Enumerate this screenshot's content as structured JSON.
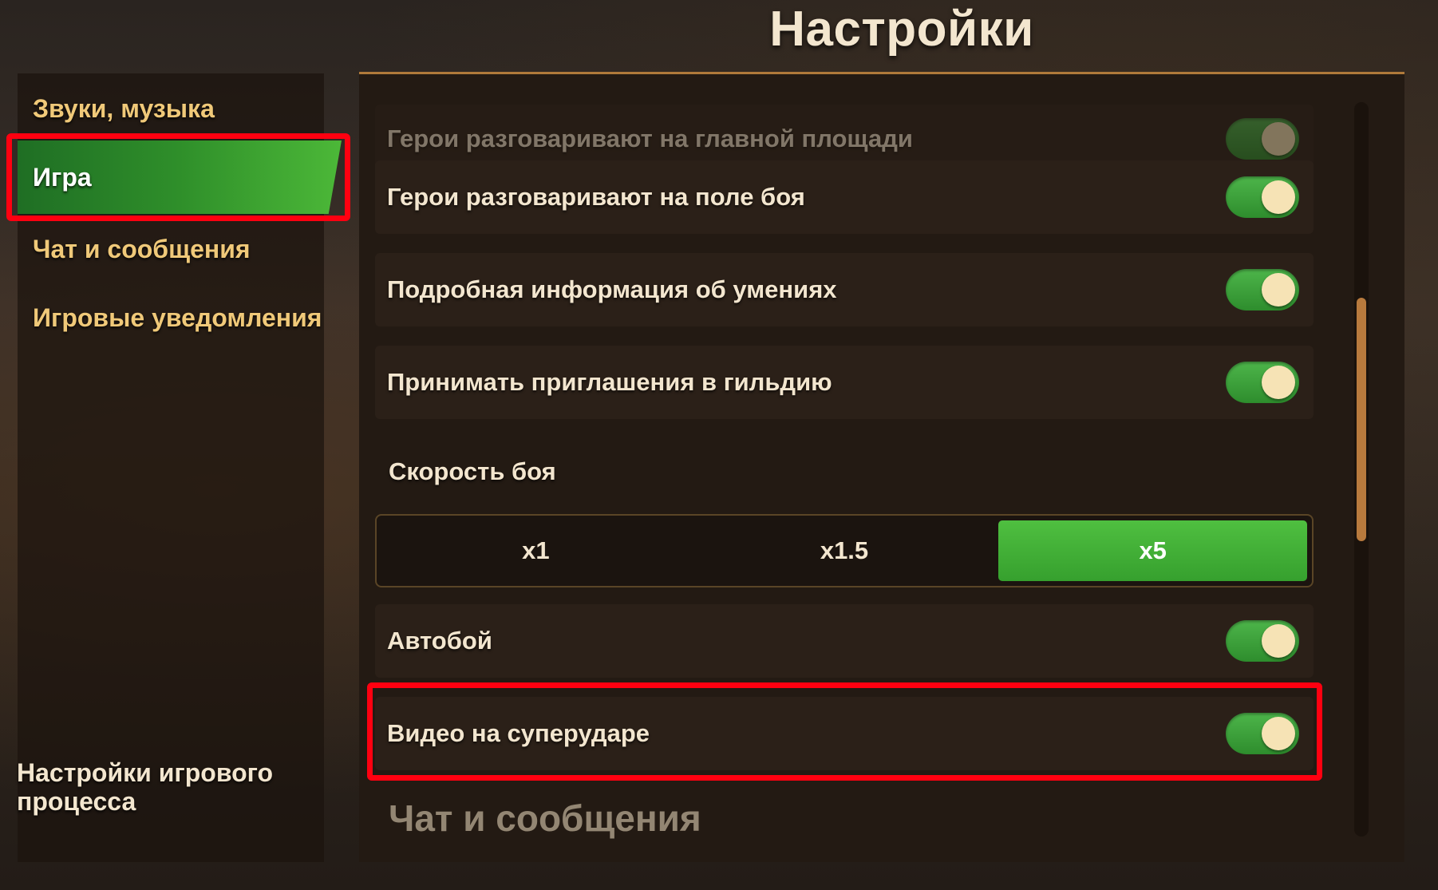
{
  "title": "Настройки",
  "sidebar": {
    "items": [
      {
        "label": "Звуки, музыка"
      },
      {
        "label": "Игра"
      },
      {
        "label": "Чат и сообщения"
      },
      {
        "label": "Игровые уведомления"
      }
    ],
    "footer": "Настройки игрового процесса"
  },
  "settings": {
    "rows": [
      {
        "label": "Герои разговаривают на главной площади",
        "on": true
      },
      {
        "label": "Герои разговаривают на поле боя",
        "on": true
      },
      {
        "label": "Подробная информация об умениях",
        "on": true
      },
      {
        "label": "Принимать приглашения в гильдию",
        "on": true
      }
    ],
    "speed": {
      "label": "Скорость боя",
      "options": [
        "x1",
        "x1.5",
        "x5"
      ],
      "selected": "x5"
    },
    "autobattle": {
      "label": "Автобой",
      "on": true
    },
    "superstrike_video": {
      "label": "Видео на суперударе",
      "on": true
    },
    "next_section": "Чат и сообщения"
  },
  "colors": {
    "accent_green": "#36a02e",
    "highlight_red": "#ff0010",
    "label_gold": "#f0c979"
  }
}
